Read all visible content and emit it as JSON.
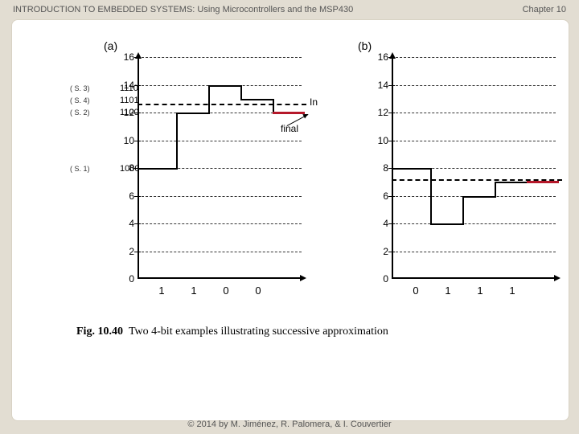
{
  "header": {
    "title": "INTRODUCTION TO EMBEDDED SYSTEMS: Using Microcontrollers and the MSP430",
    "chapter": "Chapter 10"
  },
  "footer": "© 2014 by M. Jiménez, R. Palomera, & I. Couvertier",
  "caption_lead": "Fig. 10.40",
  "caption_text": "Two 4-bit examples illustrating successive approximation",
  "labels": {
    "panel_a": "(a)",
    "panel_b": "(b)",
    "input": "In",
    "final": "final"
  },
  "y_ticks": [
    "0",
    "2",
    "4",
    "6",
    "8",
    "10",
    "12",
    "14",
    "16"
  ],
  "panel_a": {
    "bits": [
      "1",
      "1",
      "0",
      "0"
    ],
    "annotations": [
      {
        "step": "( S. 3)",
        "code": "1110"
      },
      {
        "step": "( S. 4)",
        "code": "1101"
      },
      {
        "step": "( S. 2)",
        "code": "1100"
      },
      {
        "step": "( S. 1)",
        "code": "1000"
      }
    ],
    "input_level": 12.6,
    "final_level": 12
  },
  "panel_b": {
    "bits": [
      "0",
      "1",
      "1",
      "1"
    ],
    "input_level": 7.2,
    "final_level": 7
  },
  "chart_data": [
    {
      "type": "step",
      "title": "(a) Successive approximation, input ≈ 12.6",
      "ylim": [
        0,
        16
      ],
      "x_bits": [
        "1",
        "1",
        "0",
        "0"
      ],
      "steps_y": [
        8,
        12,
        14,
        13,
        12
      ],
      "final": 12
    },
    {
      "type": "step",
      "title": "(b) Successive approximation, input ≈ 7.2",
      "ylim": [
        0,
        16
      ],
      "x_bits": [
        "0",
        "1",
        "1",
        "1"
      ],
      "steps_y": [
        8,
        4,
        6,
        7,
        7
      ],
      "final": 7
    }
  ]
}
